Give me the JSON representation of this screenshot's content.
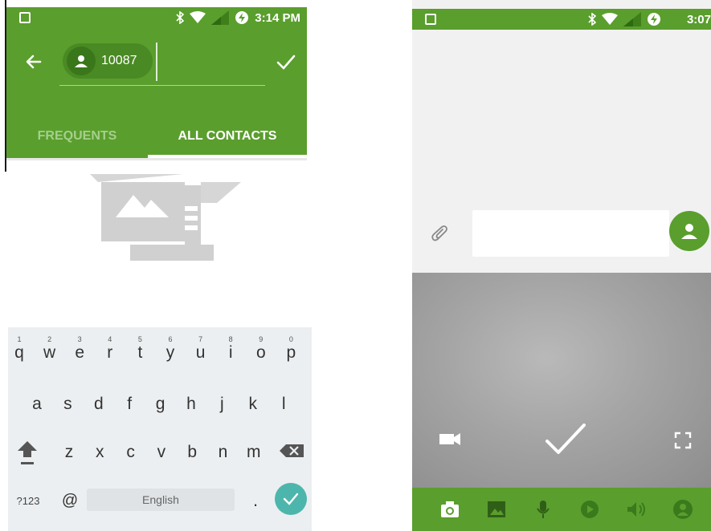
{
  "left_screen": {
    "status_bar": {
      "time": "3:14 PM"
    },
    "app_bar": {
      "recipient_chip": {
        "label": "10087"
      },
      "tabs": [
        {
          "label": "FREQUENTS",
          "selected": false
        },
        {
          "label": "ALL CONTACTS",
          "selected": true
        }
      ]
    },
    "keyboard": {
      "row1": [
        {
          "key": "q",
          "hint": "1"
        },
        {
          "key": "w",
          "hint": "2"
        },
        {
          "key": "e",
          "hint": "3"
        },
        {
          "key": "r",
          "hint": "4"
        },
        {
          "key": "t",
          "hint": "5"
        },
        {
          "key": "y",
          "hint": "6"
        },
        {
          "key": "u",
          "hint": "7"
        },
        {
          "key": "i",
          "hint": "8"
        },
        {
          "key": "o",
          "hint": "9"
        },
        {
          "key": "p",
          "hint": "0"
        }
      ],
      "row2": [
        "a",
        "s",
        "d",
        "f",
        "g",
        "h",
        "j",
        "k",
        "l"
      ],
      "row3": [
        "z",
        "x",
        "c",
        "v",
        "b",
        "n",
        "m"
      ],
      "symbols_label": "?123",
      "at_label": "@",
      "space_label": "English",
      "period_label": "."
    }
  },
  "right_screen": {
    "status_bar": {
      "time": "3:07"
    }
  },
  "colors": {
    "primary_green": "#5a9e2d",
    "keyboard_bg": "#eceff1",
    "done_teal": "#4db6ac"
  }
}
